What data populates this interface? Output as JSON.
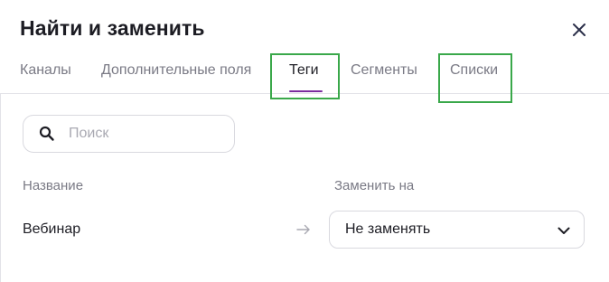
{
  "dialog": {
    "title": "Найти и заменить"
  },
  "tabs": [
    {
      "label": "Каналы",
      "active": false
    },
    {
      "label": "Дополнительные поля",
      "active": false
    },
    {
      "label": "Теги",
      "active": true
    },
    {
      "label": "Сегменты",
      "active": false
    },
    {
      "label": "Списки",
      "active": false
    }
  ],
  "search": {
    "placeholder": "Поиск",
    "value": ""
  },
  "columns": {
    "name": "Название",
    "replace_with": "Заменить на"
  },
  "rows": [
    {
      "name": "Вебинар",
      "replace_value": "Не заменять"
    }
  ],
  "colors": {
    "active_tab_underline": "#7b2b9e",
    "highlight_frame": "#3aa84a"
  }
}
